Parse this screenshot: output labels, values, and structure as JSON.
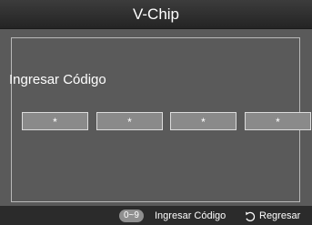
{
  "header": {
    "title": "V-Chip"
  },
  "content": {
    "prompt": "Ingresar Código"
  },
  "code_boxes": [
    "*",
    "*",
    "*",
    "*"
  ],
  "footer": {
    "hint_key": "0~9",
    "hint_label": "Ingresar Código",
    "back_icon": "return-arrow-icon",
    "back_label": "Regresar"
  }
}
